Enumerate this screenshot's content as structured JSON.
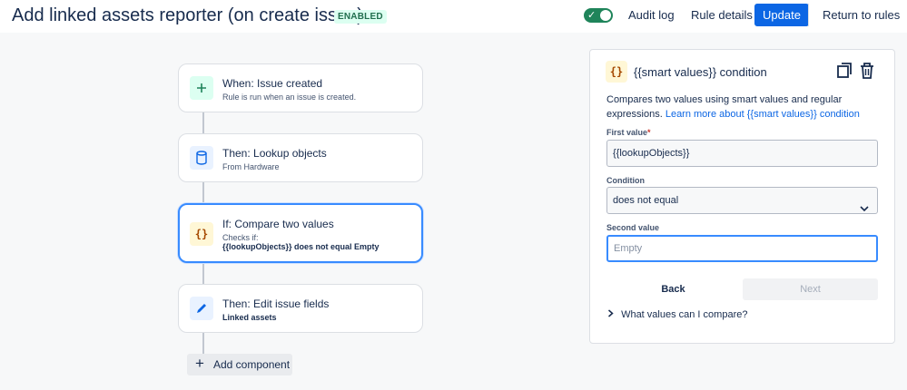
{
  "header": {
    "title": "Add linked assets reporter (on create issue)",
    "status_badge": "ENABLED",
    "toggle_check": "✓",
    "audit_log": "Audit log",
    "rule_details": "Rule details",
    "update": "Update",
    "return_to_rules": "Return to rules"
  },
  "flow": {
    "steps": [
      {
        "title": "When: Issue created",
        "subtitle": "Rule is run when an issue is created.",
        "icon": "plus-icon",
        "icon_bg": "#dcfff1",
        "icon_color": "#1f845a"
      },
      {
        "title": "Then: Lookup objects",
        "subtitle": "From Hardware",
        "icon": "database-icon",
        "icon_bg": "#e9f2ff",
        "icon_color": "#0c66e4"
      },
      {
        "title": "If: Compare two values",
        "subtitle": "Checks if:",
        "detail": "{{lookupObjects}} does not equal Empty",
        "icon": "braces-icon",
        "icon_bg": "#fff7d6",
        "icon_color": "#a54800"
      },
      {
        "title": "Then: Edit issue fields",
        "subtitle": "Linked assets",
        "icon": "pencil-icon",
        "icon_bg": "#e9f2ff",
        "icon_color": "#0c66e4"
      }
    ],
    "add_component": "Add component"
  },
  "panel": {
    "icon_glyph": "{}",
    "title": "{{smart values}} condition",
    "description": "Compares two values using smart values and regular expressions.",
    "learn_more": "Learn more about {{smart values}} condition",
    "first_value_label": "First value",
    "required_mark": "*",
    "first_value": "{{lookupObjects}}",
    "condition_label": "Condition",
    "condition_value": "does not equal",
    "second_value_label": "Second value",
    "second_value": "Empty",
    "back": "Back",
    "next": "Next",
    "more_toggle": "What values can I compare?"
  },
  "colors": {
    "primary": "#0c66e4",
    "toggle_on": "#1f845a",
    "selected_border": "#388bff"
  }
}
